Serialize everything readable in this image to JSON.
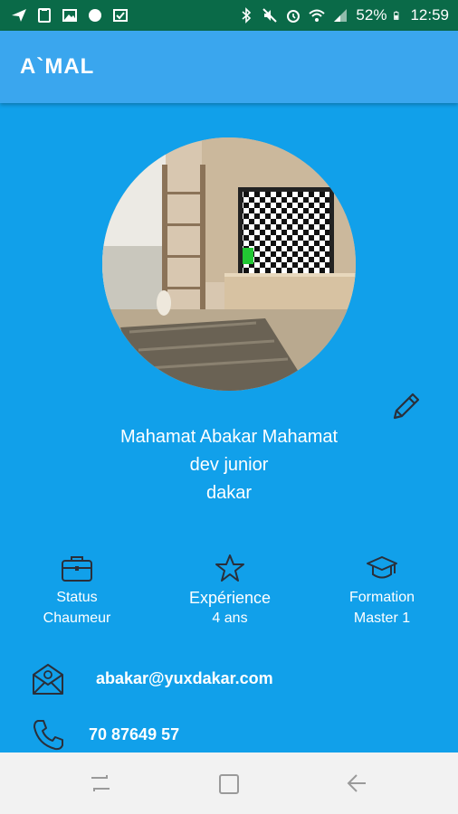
{
  "status_bar": {
    "battery": "52%",
    "time": "12:59"
  },
  "app_bar": {
    "title": "A`MAL"
  },
  "profile": {
    "name": "Mahamat Abakar Mahamat",
    "role": "dev junior",
    "city": "dakar"
  },
  "info": {
    "status_label": "Status",
    "status_value": "Chaumeur",
    "experience_label": "Expérience",
    "experience_value": "4 ans",
    "formation_label": "Formation",
    "formation_value": "Master 1"
  },
  "contact": {
    "email": "abakar@yuxdakar.com",
    "phone": "70 87649 57"
  },
  "colors": {
    "background": "#11a0ea",
    "app_bar": "#3aa6ee",
    "status_bar": "#0a6a48",
    "nav_bar": "#f2f2f2"
  },
  "icons": {
    "status": "briefcase-icon",
    "experience": "star-icon",
    "formation": "graduation-cap-icon",
    "email": "envelope-at-icon",
    "phone": "phone-icon",
    "edit": "pencil-icon"
  }
}
